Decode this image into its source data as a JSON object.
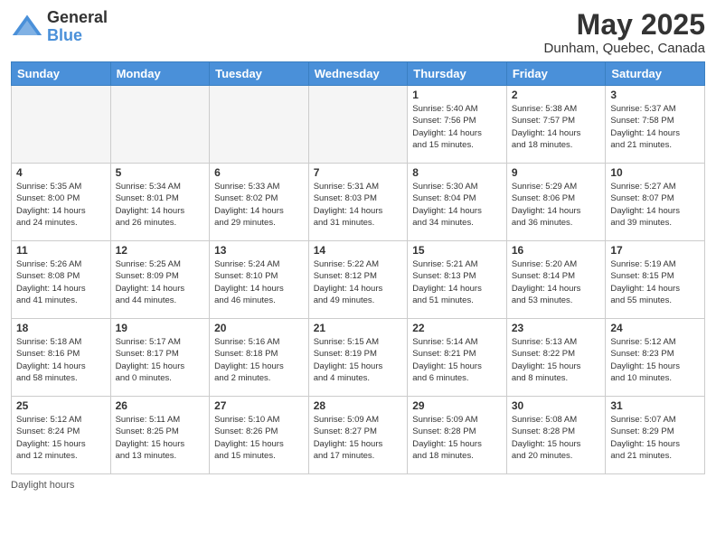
{
  "header": {
    "logo_general": "General",
    "logo_blue": "Blue",
    "title": "May 2025",
    "subtitle": "Dunham, Quebec, Canada"
  },
  "days_of_week": [
    "Sunday",
    "Monday",
    "Tuesday",
    "Wednesday",
    "Thursday",
    "Friday",
    "Saturday"
  ],
  "weeks": [
    [
      {
        "day": "",
        "info": ""
      },
      {
        "day": "",
        "info": ""
      },
      {
        "day": "",
        "info": ""
      },
      {
        "day": "",
        "info": ""
      },
      {
        "day": "1",
        "info": "Sunrise: 5:40 AM\nSunset: 7:56 PM\nDaylight: 14 hours\nand 15 minutes."
      },
      {
        "day": "2",
        "info": "Sunrise: 5:38 AM\nSunset: 7:57 PM\nDaylight: 14 hours\nand 18 minutes."
      },
      {
        "day": "3",
        "info": "Sunrise: 5:37 AM\nSunset: 7:58 PM\nDaylight: 14 hours\nand 21 minutes."
      }
    ],
    [
      {
        "day": "4",
        "info": "Sunrise: 5:35 AM\nSunset: 8:00 PM\nDaylight: 14 hours\nand 24 minutes."
      },
      {
        "day": "5",
        "info": "Sunrise: 5:34 AM\nSunset: 8:01 PM\nDaylight: 14 hours\nand 26 minutes."
      },
      {
        "day": "6",
        "info": "Sunrise: 5:33 AM\nSunset: 8:02 PM\nDaylight: 14 hours\nand 29 minutes."
      },
      {
        "day": "7",
        "info": "Sunrise: 5:31 AM\nSunset: 8:03 PM\nDaylight: 14 hours\nand 31 minutes."
      },
      {
        "day": "8",
        "info": "Sunrise: 5:30 AM\nSunset: 8:04 PM\nDaylight: 14 hours\nand 34 minutes."
      },
      {
        "day": "9",
        "info": "Sunrise: 5:29 AM\nSunset: 8:06 PM\nDaylight: 14 hours\nand 36 minutes."
      },
      {
        "day": "10",
        "info": "Sunrise: 5:27 AM\nSunset: 8:07 PM\nDaylight: 14 hours\nand 39 minutes."
      }
    ],
    [
      {
        "day": "11",
        "info": "Sunrise: 5:26 AM\nSunset: 8:08 PM\nDaylight: 14 hours\nand 41 minutes."
      },
      {
        "day": "12",
        "info": "Sunrise: 5:25 AM\nSunset: 8:09 PM\nDaylight: 14 hours\nand 44 minutes."
      },
      {
        "day": "13",
        "info": "Sunrise: 5:24 AM\nSunset: 8:10 PM\nDaylight: 14 hours\nand 46 minutes."
      },
      {
        "day": "14",
        "info": "Sunrise: 5:22 AM\nSunset: 8:12 PM\nDaylight: 14 hours\nand 49 minutes."
      },
      {
        "day": "15",
        "info": "Sunrise: 5:21 AM\nSunset: 8:13 PM\nDaylight: 14 hours\nand 51 minutes."
      },
      {
        "day": "16",
        "info": "Sunrise: 5:20 AM\nSunset: 8:14 PM\nDaylight: 14 hours\nand 53 minutes."
      },
      {
        "day": "17",
        "info": "Sunrise: 5:19 AM\nSunset: 8:15 PM\nDaylight: 14 hours\nand 55 minutes."
      }
    ],
    [
      {
        "day": "18",
        "info": "Sunrise: 5:18 AM\nSunset: 8:16 PM\nDaylight: 14 hours\nand 58 minutes."
      },
      {
        "day": "19",
        "info": "Sunrise: 5:17 AM\nSunset: 8:17 PM\nDaylight: 15 hours\nand 0 minutes."
      },
      {
        "day": "20",
        "info": "Sunrise: 5:16 AM\nSunset: 8:18 PM\nDaylight: 15 hours\nand 2 minutes."
      },
      {
        "day": "21",
        "info": "Sunrise: 5:15 AM\nSunset: 8:19 PM\nDaylight: 15 hours\nand 4 minutes."
      },
      {
        "day": "22",
        "info": "Sunrise: 5:14 AM\nSunset: 8:21 PM\nDaylight: 15 hours\nand 6 minutes."
      },
      {
        "day": "23",
        "info": "Sunrise: 5:13 AM\nSunset: 8:22 PM\nDaylight: 15 hours\nand 8 minutes."
      },
      {
        "day": "24",
        "info": "Sunrise: 5:12 AM\nSunset: 8:23 PM\nDaylight: 15 hours\nand 10 minutes."
      }
    ],
    [
      {
        "day": "25",
        "info": "Sunrise: 5:12 AM\nSunset: 8:24 PM\nDaylight: 15 hours\nand 12 minutes."
      },
      {
        "day": "26",
        "info": "Sunrise: 5:11 AM\nSunset: 8:25 PM\nDaylight: 15 hours\nand 13 minutes."
      },
      {
        "day": "27",
        "info": "Sunrise: 5:10 AM\nSunset: 8:26 PM\nDaylight: 15 hours\nand 15 minutes."
      },
      {
        "day": "28",
        "info": "Sunrise: 5:09 AM\nSunset: 8:27 PM\nDaylight: 15 hours\nand 17 minutes."
      },
      {
        "day": "29",
        "info": "Sunrise: 5:09 AM\nSunset: 8:28 PM\nDaylight: 15 hours\nand 18 minutes."
      },
      {
        "day": "30",
        "info": "Sunrise: 5:08 AM\nSunset: 8:28 PM\nDaylight: 15 hours\nand 20 minutes."
      },
      {
        "day": "31",
        "info": "Sunrise: 5:07 AM\nSunset: 8:29 PM\nDaylight: 15 hours\nand 21 minutes."
      }
    ]
  ],
  "footer": {
    "daylight_hours": "Daylight hours"
  }
}
